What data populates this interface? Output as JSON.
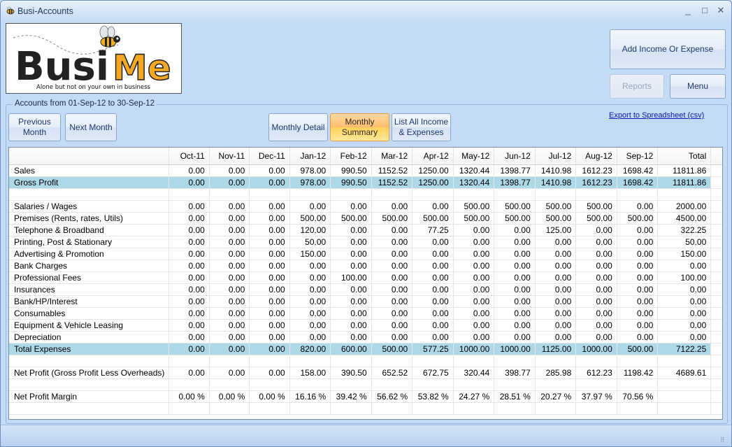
{
  "window": {
    "title": "Busi-Accounts",
    "controls": {
      "minimize": "_",
      "maximize": "□",
      "close": "✕"
    }
  },
  "logo": {
    "brand_dark": "Busi",
    "brand_accent": "Me",
    "tagline": "Alone but not on your own in business",
    "accent_color": "#f5a623"
  },
  "toolbar": {
    "add_income_expense": "Add Income Or Expense",
    "reports": "Reports",
    "menu": "Menu"
  },
  "accounts": {
    "group_title": "Accounts from 01-Sep-12 to 30-Sep-12",
    "previous_month": "Previous Month",
    "next_month": "Next Month",
    "monthly_detail": "Monthly Detail",
    "monthly_summary": "Monthly Summary",
    "list_all": "List All Income & Expenses",
    "export": "Export to Spreadsheet (csv)"
  },
  "table": {
    "columns": [
      "",
      "Oct-11",
      "Nov-11",
      "Dec-11",
      "Jan-12",
      "Feb-12",
      "Mar-12",
      "Apr-12",
      "May-12",
      "Jun-12",
      "Jul-12",
      "Aug-12",
      "Sep-12",
      "Total"
    ],
    "rows": [
      {
        "type": "normal",
        "cells": [
          "Sales",
          "0.00",
          "0.00",
          "0.00",
          "978.00",
          "990.50",
          "1152.52",
          "1250.00",
          "1320.44",
          "1398.77",
          "1410.98",
          "1612.23",
          "1698.42",
          "11811.86"
        ]
      },
      {
        "type": "hl",
        "cells": [
          "Gross Profit",
          "0.00",
          "0.00",
          "0.00",
          "978.00",
          "990.50",
          "1152.52",
          "1250.00",
          "1320.44",
          "1398.77",
          "1410.98",
          "1612.23",
          "1698.42",
          "11811.86"
        ]
      },
      {
        "type": "spacer",
        "cells": [
          "",
          "",
          "",
          "",
          "",
          "",
          "",
          "",
          "",
          "",
          "",
          "",
          "",
          ""
        ]
      },
      {
        "type": "normal",
        "cells": [
          "Salaries / Wages",
          "0.00",
          "0.00",
          "0.00",
          "0.00",
          "0.00",
          "0.00",
          "0.00",
          "500.00",
          "500.00",
          "500.00",
          "500.00",
          "0.00",
          "2000.00"
        ]
      },
      {
        "type": "normal",
        "cells": [
          "Premises (Rents, rates, Utils)",
          "0.00",
          "0.00",
          "0.00",
          "500.00",
          "500.00",
          "500.00",
          "500.00",
          "500.00",
          "500.00",
          "500.00",
          "500.00",
          "500.00",
          "4500.00"
        ]
      },
      {
        "type": "normal",
        "cells": [
          "Telephone & Broadband",
          "0.00",
          "0.00",
          "0.00",
          "120.00",
          "0.00",
          "0.00",
          "77.25",
          "0.00",
          "0.00",
          "125.00",
          "0.00",
          "0.00",
          "322.25"
        ]
      },
      {
        "type": "normal",
        "cells": [
          "Printing, Post & Stationary",
          "0.00",
          "0.00",
          "0.00",
          "50.00",
          "0.00",
          "0.00",
          "0.00",
          "0.00",
          "0.00",
          "0.00",
          "0.00",
          "0.00",
          "50.00"
        ]
      },
      {
        "type": "normal",
        "cells": [
          "Advertising & Promotion",
          "0.00",
          "0.00",
          "0.00",
          "150.00",
          "0.00",
          "0.00",
          "0.00",
          "0.00",
          "0.00",
          "0.00",
          "0.00",
          "0.00",
          "150.00"
        ]
      },
      {
        "type": "normal",
        "cells": [
          "Bank Charges",
          "0.00",
          "0.00",
          "0.00",
          "0.00",
          "0.00",
          "0.00",
          "0.00",
          "0.00",
          "0.00",
          "0.00",
          "0.00",
          "0.00",
          "0.00"
        ]
      },
      {
        "type": "normal",
        "cells": [
          "Professional Fees",
          "0.00",
          "0.00",
          "0.00",
          "0.00",
          "100.00",
          "0.00",
          "0.00",
          "0.00",
          "0.00",
          "0.00",
          "0.00",
          "0.00",
          "100.00"
        ]
      },
      {
        "type": "normal",
        "cells": [
          "Insurances",
          "0.00",
          "0.00",
          "0.00",
          "0.00",
          "0.00",
          "0.00",
          "0.00",
          "0.00",
          "0.00",
          "0.00",
          "0.00",
          "0.00",
          "0.00"
        ]
      },
      {
        "type": "normal",
        "cells": [
          "Bank/HP/Interest",
          "0.00",
          "0.00",
          "0.00",
          "0.00",
          "0.00",
          "0.00",
          "0.00",
          "0.00",
          "0.00",
          "0.00",
          "0.00",
          "0.00",
          "0.00"
        ]
      },
      {
        "type": "normal",
        "cells": [
          "Consumables",
          "0.00",
          "0.00",
          "0.00",
          "0.00",
          "0.00",
          "0.00",
          "0.00",
          "0.00",
          "0.00",
          "0.00",
          "0.00",
          "0.00",
          "0.00"
        ]
      },
      {
        "type": "normal",
        "cells": [
          "Equipment & Vehicle Leasing",
          "0.00",
          "0.00",
          "0.00",
          "0.00",
          "0.00",
          "0.00",
          "0.00",
          "0.00",
          "0.00",
          "0.00",
          "0.00",
          "0.00",
          "0.00"
        ]
      },
      {
        "type": "normal",
        "cells": [
          "Depreciation",
          "0.00",
          "0.00",
          "0.00",
          "0.00",
          "0.00",
          "0.00",
          "0.00",
          "0.00",
          "0.00",
          "0.00",
          "0.00",
          "0.00",
          "0.00"
        ]
      },
      {
        "type": "hl",
        "cells": [
          "Total Expenses",
          "0.00",
          "0.00",
          "0.00",
          "820.00",
          "600.00",
          "500.00",
          "577.25",
          "1000.00",
          "1000.00",
          "1125.00",
          "1000.00",
          "500.00",
          "7122.25"
        ]
      },
      {
        "type": "spacer",
        "cells": [
          "",
          "",
          "",
          "",
          "",
          "",
          "",
          "",
          "",
          "",
          "",
          "",
          "",
          ""
        ]
      },
      {
        "type": "normal",
        "cells": [
          "Net Profit (Gross Profit Less Overheads)",
          "0.00",
          "0.00",
          "0.00",
          "158.00",
          "390.50",
          "652.52",
          "672.75",
          "320.44",
          "398.77",
          "285.98",
          "612.23",
          "1198.42",
          "4689.61"
        ]
      },
      {
        "type": "spacer",
        "cells": [
          "",
          "",
          "",
          "",
          "",
          "",
          "",
          "",
          "",
          "",
          "",
          "",
          "",
          ""
        ]
      },
      {
        "type": "normal",
        "cells": [
          "Net Profit Margin",
          "0.00 %",
          "0.00 %",
          "0.00 %",
          "16.16 %",
          "39.42 %",
          "56.62 %",
          "53.82 %",
          "24.27 %",
          "28.51 %",
          "20.27 %",
          "37.97 %",
          "70.56 %",
          ""
        ]
      },
      {
        "type": "spacer",
        "cells": [
          "",
          "",
          "",
          "",
          "",
          "",
          "",
          "",
          "",
          "",
          "",
          "",
          "",
          ""
        ]
      }
    ]
  },
  "colors": {
    "highlight_row": "#add8e6",
    "active_button": "#ffbd6b",
    "link": "#0b18b5"
  }
}
